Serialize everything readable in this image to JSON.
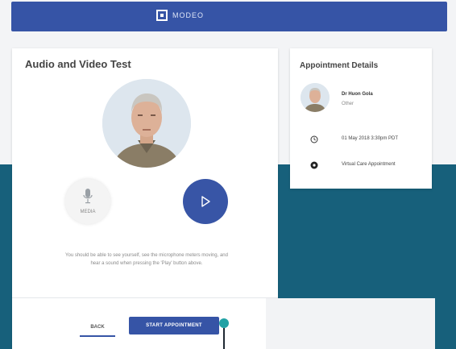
{
  "header": {
    "brand_name": "MODEO"
  },
  "main": {
    "title": "Audio and Video Test",
    "mic_label": "MEDIA",
    "help_text": "You should be able to see yourself, see the microphone meters moving, and hear a sound when pressing the 'Play' button above.",
    "back_label": "BACK",
    "start_label": "START APPOINTMENT"
  },
  "appointment": {
    "title": "Appointment Details",
    "doctor_name": "Dr Huon Gola",
    "doctor_role": "Other",
    "datetime": "01 May 2018 3:30pm PDT",
    "type": "Virtual Care Appointment"
  },
  "colors": {
    "brand_blue": "#3654a6",
    "teal_bg": "#17607b",
    "accent_teal": "#22a2a5"
  },
  "icons": [
    "modeo-logo-icon",
    "microphone-icon",
    "play-icon",
    "clock-icon",
    "video-dot-icon"
  ]
}
